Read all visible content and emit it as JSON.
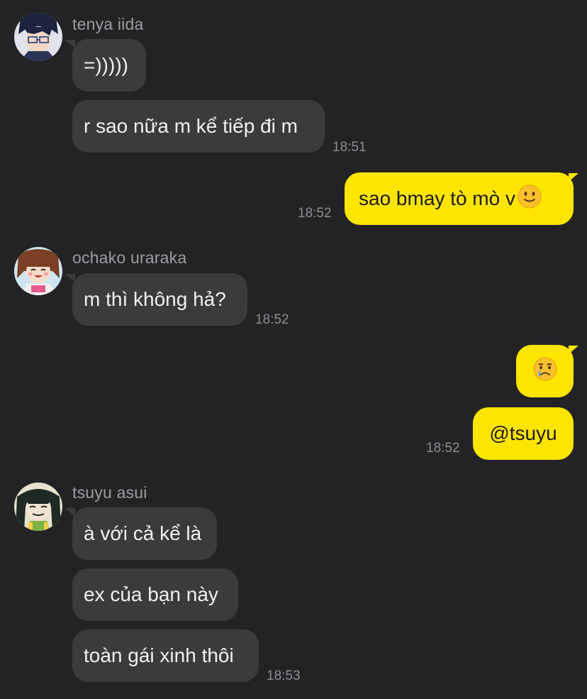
{
  "messages": {
    "tenya_name": "tenya iida",
    "tenya_msg1": "=)))))",
    "tenya_msg2": "r sao nữa m kể tiếp đi m",
    "tenya_time": "18:51",
    "me_msg1": "sao bmay tò mò v",
    "me_msg1_emoji": "slightly-smiling-face-icon",
    "me_time1": "18:52",
    "ochako_name": "ochako uraraka",
    "ochako_msg1": "m thì không hả?",
    "ochako_time": "18:52",
    "me_msg2_emoji": "crying-face-icon",
    "me_msg3": "@tsuyu",
    "me_time2": "18:52",
    "tsuyu_name": "tsuyu asui",
    "tsuyu_msg1": "à với cả kể là",
    "tsuyu_msg2": "ex của bạn này",
    "tsuyu_msg3": "toàn gái xinh thôi",
    "tsuyu_time": "18:53"
  },
  "colors": {
    "background": "#232325",
    "incoming_bubble": "#3b3b3e",
    "outgoing_bubble": "#fee500",
    "timestamp": "#8e8e93",
    "sender_name": "#9d9da2"
  }
}
